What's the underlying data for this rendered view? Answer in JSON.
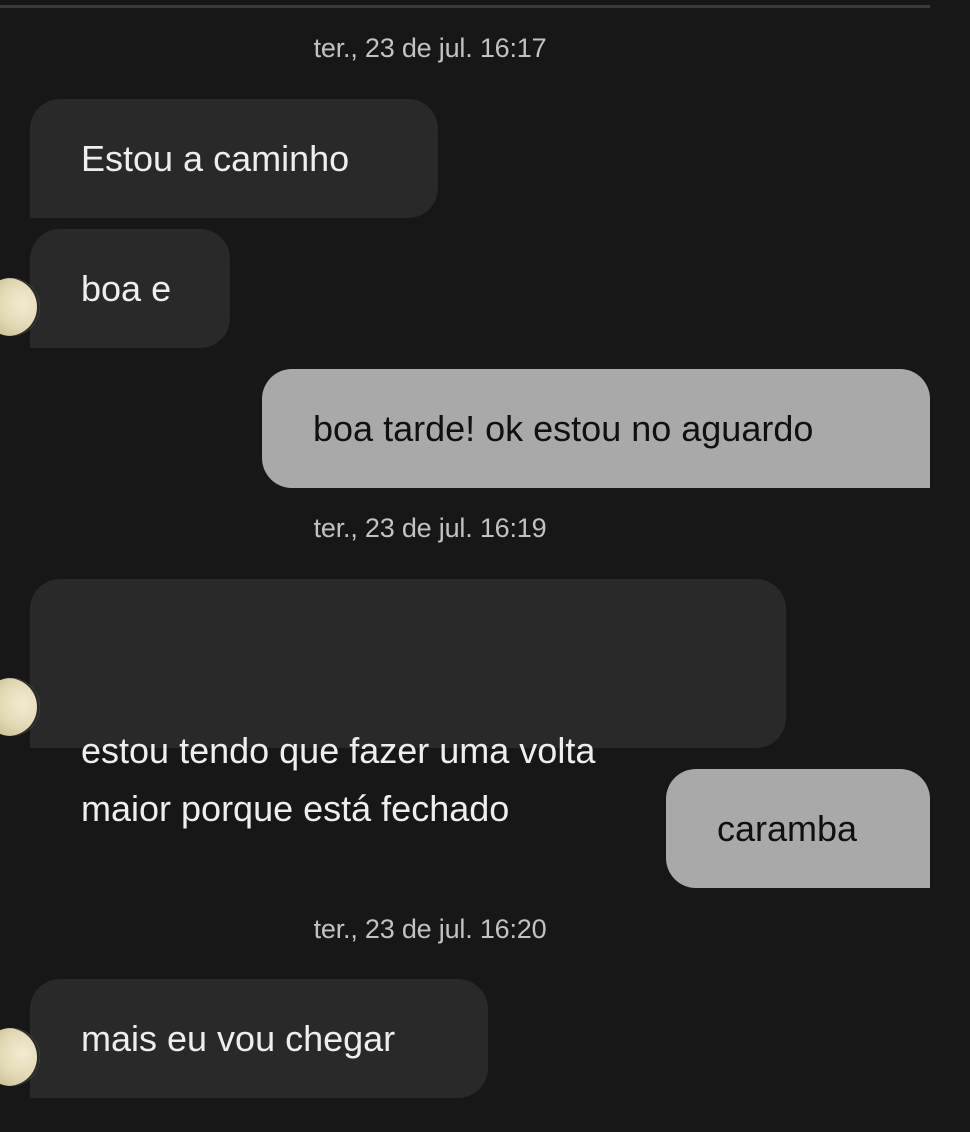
{
  "conversation": {
    "groups": [
      {
        "timestamp": "ter., 23 de jul. 16:17",
        "messages": [
          {
            "direction": "in",
            "text": "Estou a caminho"
          },
          {
            "direction": "in",
            "text": "boa e"
          },
          {
            "direction": "out",
            "text": "boa tarde! ok estou no aguardo"
          }
        ]
      },
      {
        "timestamp": "ter., 23 de jul. 16:19",
        "messages": [
          {
            "direction": "in",
            "text": "estou tendo que fazer uma volta\nmaior porque está fechado"
          },
          {
            "direction": "out",
            "text": "caramba"
          }
        ]
      },
      {
        "timestamp": "ter., 23 de jul. 16:20",
        "messages": [
          {
            "direction": "in",
            "text": "mais eu vou chegar"
          }
        ]
      }
    ]
  },
  "icons": {
    "sender_avatar": "avatar-photo"
  },
  "colors": {
    "background": "#171717",
    "incoming_bubble": "#292929",
    "incoming_text": "#eeeeee",
    "outgoing_bubble": "#a9a9a9",
    "outgoing_text": "#101010",
    "timestamp_text": "#c2c2c2"
  }
}
